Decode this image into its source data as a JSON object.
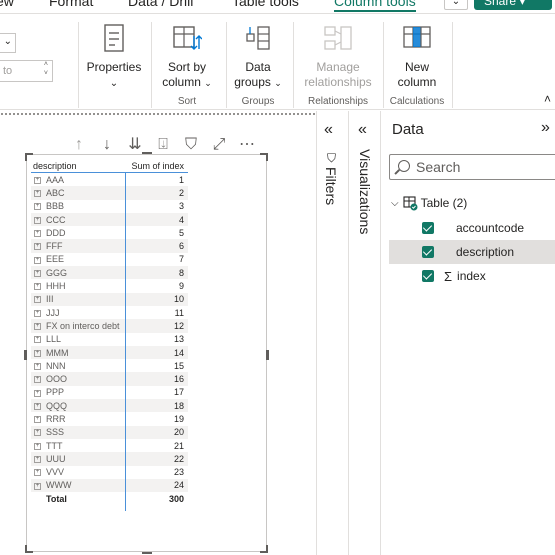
{
  "menu": {
    "tabs": [
      "ew",
      "Format",
      "Data / Drill",
      "Table tools",
      "Column tools"
    ],
    "share_label": "Share",
    "dropdown_glyph": "⌄"
  },
  "ribbon": {
    "left_field_value": "to",
    "buttons": {
      "properties": "Properties",
      "sort_by_column_1": "Sort by",
      "sort_by_column_2": "column",
      "data_groups_1": "Data",
      "data_groups_2": "groups",
      "manage_rel_1": "Manage",
      "manage_rel_2": "relationships",
      "new_column_1": "New",
      "new_column_2": "column"
    },
    "groups": {
      "sort": "Sort",
      "groups": "Groups",
      "relationships": "Relationships",
      "calculations": "Calculations"
    }
  },
  "visual_toolbar": {
    "icons": [
      "up-arrow-icon",
      "down-arrow-icon",
      "double-down-arrow-icon",
      "expand-all-icon",
      "filter-icon",
      "focus-mode-icon",
      "more-options-icon"
    ]
  },
  "table": {
    "headers": {
      "description": "description",
      "index": "Sum of index"
    },
    "rows": [
      {
        "desc": "AAA",
        "idx": "1"
      },
      {
        "desc": "ABC",
        "idx": "2"
      },
      {
        "desc": "BBB",
        "idx": "3"
      },
      {
        "desc": "CCC",
        "idx": "4"
      },
      {
        "desc": "DDD",
        "idx": "5"
      },
      {
        "desc": "FFF",
        "idx": "6"
      },
      {
        "desc": "EEE",
        "idx": "7"
      },
      {
        "desc": "GGG",
        "idx": "8"
      },
      {
        "desc": "HHH",
        "idx": "9"
      },
      {
        "desc": "III",
        "idx": "10"
      },
      {
        "desc": "JJJ",
        "idx": "11"
      },
      {
        "desc": "FX on interco debt",
        "idx": "12"
      },
      {
        "desc": "LLL",
        "idx": "13"
      },
      {
        "desc": "MMM",
        "idx": "14"
      },
      {
        "desc": "NNN",
        "idx": "15"
      },
      {
        "desc": "OOO",
        "idx": "16"
      },
      {
        "desc": "PPP",
        "idx": "17"
      },
      {
        "desc": "QQQ",
        "idx": "18"
      },
      {
        "desc": "RRR",
        "idx": "19"
      },
      {
        "desc": "SSS",
        "idx": "20"
      },
      {
        "desc": "TTT",
        "idx": "21"
      },
      {
        "desc": "UUU",
        "idx": "22"
      },
      {
        "desc": "VVV",
        "idx": "23"
      },
      {
        "desc": "WWW",
        "idx": "24"
      }
    ],
    "total_label": "Total",
    "total_value": "300"
  },
  "filters_pane": {
    "label": "Filters",
    "chevron": "«"
  },
  "visualizations_pane": {
    "label": "Visualizations",
    "chevron": "«"
  },
  "data_pane": {
    "title": "Data",
    "expand_glyph": "»",
    "search_placeholder": "Search",
    "table_name": "Table (2)",
    "fields": [
      {
        "name": "accountcode",
        "checked": true
      },
      {
        "name": "description",
        "checked": true
      },
      {
        "name": "index",
        "checked": true
      }
    ]
  },
  "colors": {
    "accent": "#117865",
    "selection": "#e1dfdd",
    "table_line": "#4a90d9"
  }
}
